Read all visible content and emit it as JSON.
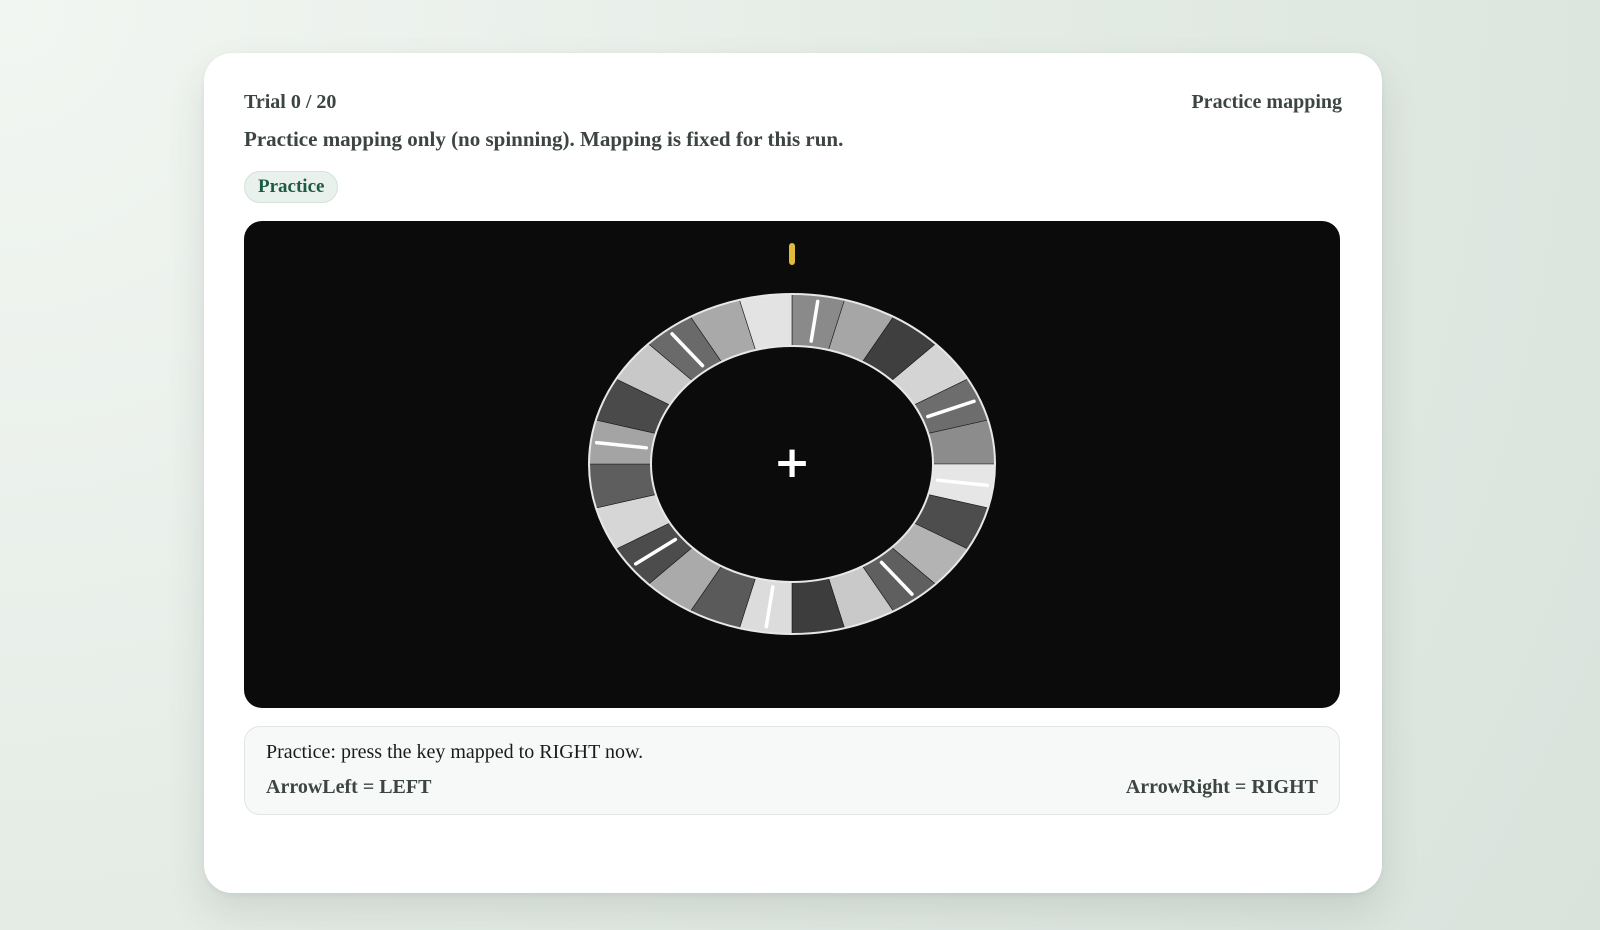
{
  "header": {
    "trial": "Trial 0 / 20",
    "mode": "Practice mapping"
  },
  "subtitle": "Practice mapping only (no spinning). Mapping is fixed for this run.",
  "badge": "Practice",
  "wheel": {
    "segments": 24,
    "shades": [
      "#8a8a8a",
      "#a6a6a6",
      "#3f3f3f",
      "#d4d4d4",
      "#6d6d6d",
      "#8c8c8c",
      "#e6e6e6",
      "#4d4d4d",
      "#b3b3b3",
      "#5f5f5f",
      "#c9c9c9",
      "#3d3d3d",
      "#dcdcdc",
      "#5a5a5a",
      "#aaaaaa",
      "#4c4c4c",
      "#d6d6d6",
      "#5e5e5e",
      "#a4a4a4",
      "#4a4a4a",
      "#c8c8c8",
      "#6a6a6a",
      "#a9a9a9",
      "#e3e3e3"
    ],
    "tick_segments": [
      0,
      4,
      6,
      9,
      12,
      15,
      18,
      21
    ],
    "pointer_color": "#e0b93a",
    "fixation_symbol": "+"
  },
  "panel": {
    "instruction": "Practice: press the key mapped to RIGHT now.",
    "left_mapping": "ArrowLeft = LEFT",
    "right_mapping": "ArrowRight = RIGHT"
  }
}
